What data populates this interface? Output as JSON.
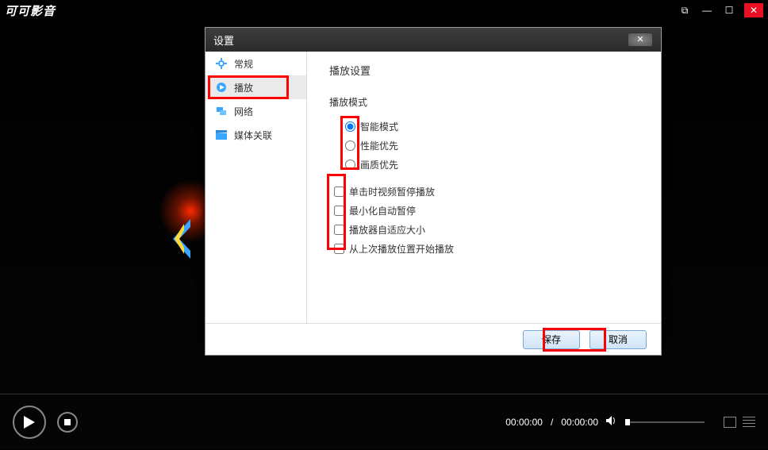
{
  "window": {
    "title": "可可影音"
  },
  "player": {
    "time_current": "00:00:00",
    "time_total": "00:00:00",
    "time_sep": " / "
  },
  "dialog": {
    "title": "设置",
    "sidebar": {
      "items": [
        {
          "label": "常规",
          "icon": "gear-icon"
        },
        {
          "label": "播放",
          "icon": "play-circle-icon"
        },
        {
          "label": "网络",
          "icon": "network-icon"
        },
        {
          "label": "媒体关联",
          "icon": "clapper-icon"
        }
      ],
      "active_index": 1
    },
    "content": {
      "heading": "播放设置",
      "mode_group_label": "播放模式",
      "modes": [
        {
          "label": "智能模式",
          "checked": true
        },
        {
          "label": "性能优先",
          "checked": false
        },
        {
          "label": "画质优先",
          "checked": false
        }
      ],
      "checks": [
        {
          "label": "单击时视频暂停播放",
          "checked": false
        },
        {
          "label": "最小化自动暂停",
          "checked": false
        },
        {
          "label": "播放器自适应大小",
          "checked": false
        },
        {
          "label": "从上次播放位置开始播放",
          "checked": false
        }
      ]
    },
    "buttons": {
      "save": "保存",
      "cancel": "取消"
    }
  },
  "icons": {
    "pip": "⧉",
    "minimize": "—",
    "maximize": "☐",
    "close": "✕",
    "dialog_close": "✕",
    "volume": "🔊"
  },
  "colors": {
    "accent_blue": "#3aa6ff",
    "highlight_red": "#ff0000"
  }
}
